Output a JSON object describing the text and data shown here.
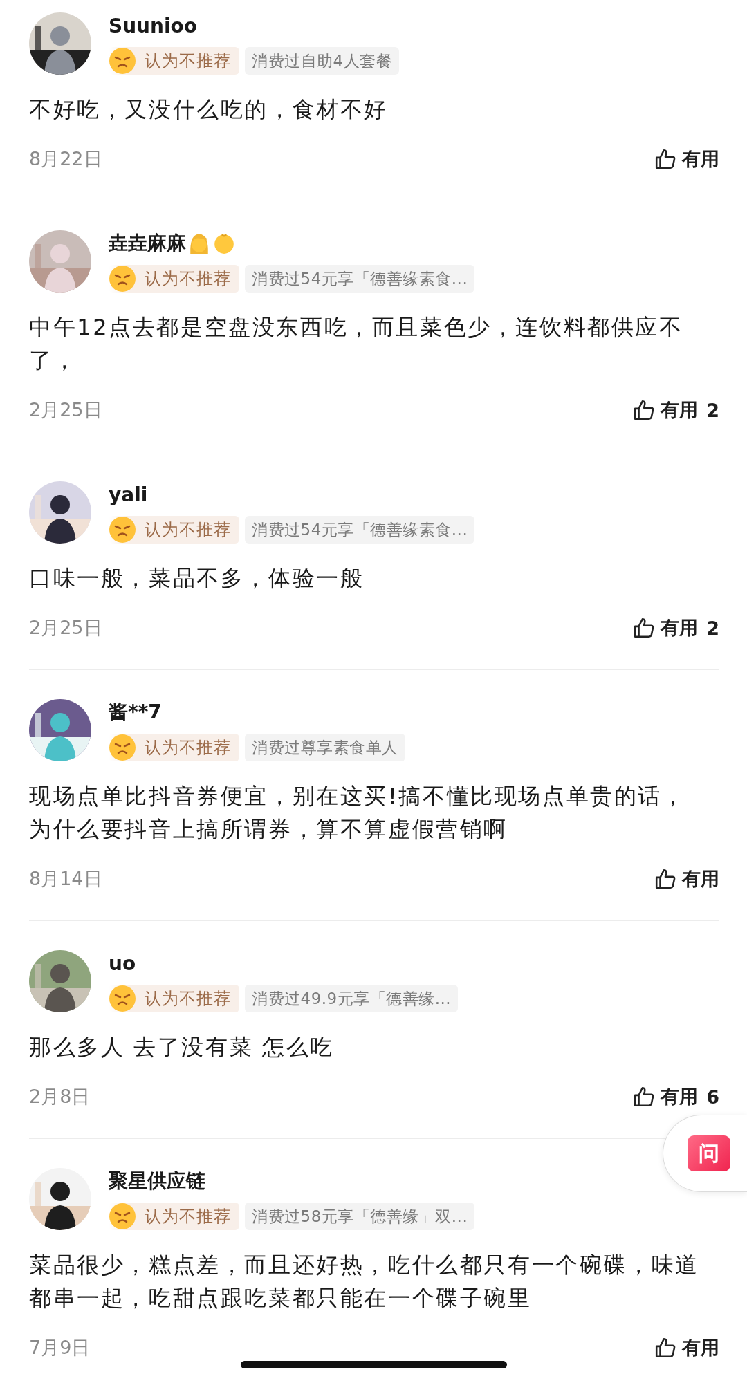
{
  "reviews": [
    {
      "name": "Suunioo",
      "rating": "认为不推荐",
      "purchase": "消费过自助4人套餐",
      "comment": "不好吃，又没什么吃的，食材不好",
      "date": "8月22日",
      "like": {
        "label": "有用"
      }
    },
    {
      "name": "垚垚麻麻",
      "name_emoji": [
        {
          "kind": "woman"
        },
        {
          "kind": "baby"
        }
      ],
      "rating": "认为不推荐",
      "purchase": "消费过54元享「德善缘素食...",
      "comment": "中午12点去都是空盘没东西吃，而且菜色少，连饮料都供应不了，",
      "date": "2月25日",
      "like": {
        "label": "有用",
        "count": "2"
      }
    },
    {
      "name": "yali",
      "rating": "认为不推荐",
      "purchase": "消费过54元享「德善缘素食...",
      "comment": "口味一般，菜品不多，体验一般",
      "date": "2月25日",
      "like": {
        "label": "有用",
        "count": "2"
      }
    },
    {
      "name": "酱**7",
      "rating": "认为不推荐",
      "purchase": "消费过尊享素食单人",
      "comment": "现场点单比抖音券便宜，别在这买!搞不懂比现场点单贵的话，为什么要抖音上搞所谓券，算不算虚假营销啊",
      "date": "8月14日",
      "like": {
        "label": "有用"
      }
    },
    {
      "name": "uo",
      "rating": "认为不推荐",
      "purchase": "消费过49.9元享「德善缘...",
      "comment": "那么多人 去了没有菜 怎么吃",
      "date": "2月8日",
      "like": {
        "label": "有用",
        "count": "6"
      }
    },
    {
      "name": "聚星供应链",
      "rating": "认为不推荐",
      "purchase": "消费过58元享「德善缘」双...",
      "comment": "菜品很少，糕点差，而且还好热，吃什么都只有一个碗碟，味道都串一起，吃甜点跟吃菜都只能在一个碟子碗里",
      "date": "7月9日",
      "like": {
        "label": "有用"
      }
    }
  ],
  "ask_button": {
    "label": "问"
  }
}
